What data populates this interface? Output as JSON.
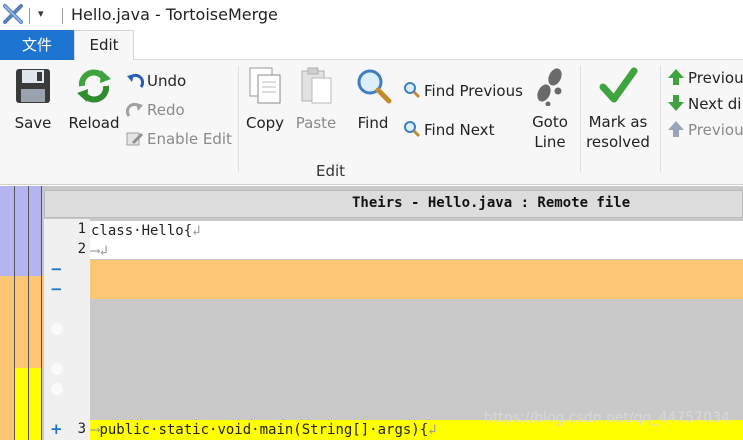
{
  "window": {
    "title": "Hello.java - TortoiseMerge",
    "qat_arrow": "▾"
  },
  "tabs": {
    "file": "文件",
    "edit": "Edit"
  },
  "ribbon": {
    "save": "Save",
    "reload": "Reload",
    "undo": "Undo",
    "redo": "Redo",
    "enable_edit": "Enable Edit",
    "copy": "Copy",
    "paste": "Paste",
    "find": "Find",
    "find_previous": "Find Previous",
    "find_next": "Find Next",
    "goto_line_1": "Goto",
    "goto_line_2": "Line",
    "mark_resolved_1": "Mark as",
    "mark_resolved_2": "resolved",
    "previous_diff": "Previou",
    "next_diff": "Next di",
    "previous_conflict": "Previou",
    "group_edit": "Edit"
  },
  "panel": {
    "header": "Theirs - Hello.java : Remote file"
  },
  "lines": [
    {
      "num": "1",
      "code": "class·Hello{"
    },
    {
      "num": "2",
      "code": ""
    },
    {
      "num": "3",
      "code": "public·static·void·main(String[]·args){"
    }
  ],
  "markers": {
    "minus": "−",
    "plus": "+"
  },
  "whitespace": {
    "tab": "⟶",
    "eol": "↲"
  },
  "watermark": "https://blog.csdn.net/qq_44757034",
  "colors": {
    "file_tab": "#1e74d1",
    "conflict_orange": "#fdc675",
    "removed_gray": "#c8c8c8",
    "added_yellow": "#ffff00",
    "gutter_purple": "#b4b4f0"
  }
}
